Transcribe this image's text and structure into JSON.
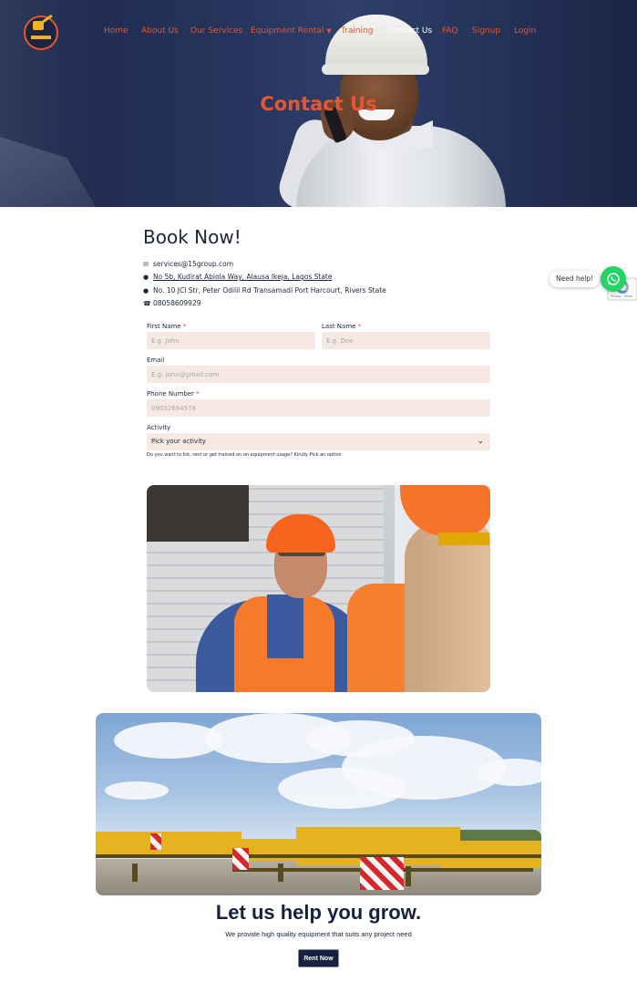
{
  "nav": {
    "items": [
      {
        "label": "Home"
      },
      {
        "label": "About Us"
      },
      {
        "label": "Our Services"
      },
      {
        "label": "Equipment Rental"
      },
      {
        "label": "Training"
      },
      {
        "label": "Contact Us"
      },
      {
        "label": "FAQ"
      },
      {
        "label": "Signup"
      },
      {
        "label": "Login"
      }
    ],
    "active": "Contact Us"
  },
  "hero": {
    "title": "Contact Us"
  },
  "contact": {
    "title": "Book Now!",
    "email": "services@15group.com",
    "address1": "No 5b, Kudirat Abiola Way, Alausa Ikeja, Lagos State",
    "address2": "No. 10 JCI Str, Peter Odilil Rd Transamadi Port Harcourt, Rivers State",
    "phone": "08058609929"
  },
  "form": {
    "first_name_label": "First Name",
    "first_name_placeholder": "E.g. John",
    "last_name_label": "Last Name",
    "last_name_placeholder": "E.g. Doe",
    "email_label": "Email",
    "email_placeholder": "E.g. john@gmail.com",
    "phone_label": "Phone Number",
    "phone_placeholder": "09032664578",
    "activity_label": "Activity",
    "activity_selected": "Pick your activity",
    "activity_hint": "Do you want to list, rent or get trained on an equipment usage? Kindly Pick an option",
    "required_marker": "*"
  },
  "widgets": {
    "help_label": "Need help!",
    "recaptcha_text": "Privacy - Terms",
    "whatsapp_color": "#25d366"
  },
  "grow": {
    "title": "Let us help you grow.",
    "subtitle": "We provide high quality equipment that suits any project need",
    "button": "Rent Now"
  },
  "colors": {
    "accent": "#e8552f",
    "navy": "#15213f",
    "field_bg": "#f7e9e2"
  }
}
